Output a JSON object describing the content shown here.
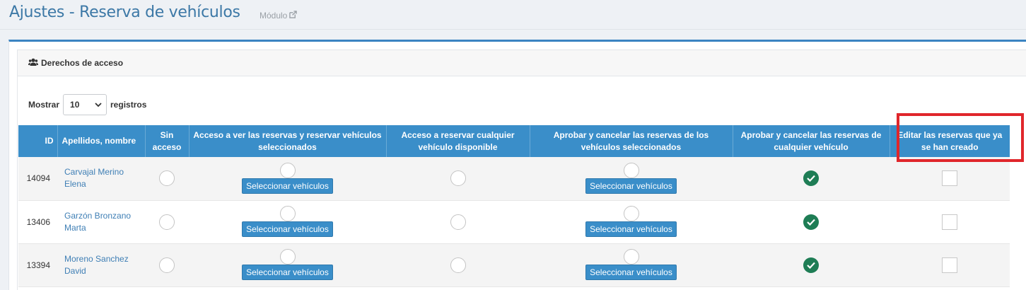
{
  "header": {
    "title": "Ajustes - Reserva de vehículos",
    "module_link": "Módulo"
  },
  "panel": {
    "title": "Derechos de acceso"
  },
  "length": {
    "prefix": "Mostrar",
    "selected": "10",
    "suffix": "registros"
  },
  "table": {
    "columns": [
      "ID",
      "Apellidos, nombre",
      "Sin acceso",
      "Acceso a ver las reservas y reservar vehículos seleccionados",
      "Acceso a reservar cualquier vehículo disponible",
      "Aprobar y cancelar las reservas de los vehículos seleccionados",
      "Aprobar y cancelar las reservas de cualquier vehículo",
      "Editar las reservas que ya se han creado"
    ],
    "select_button_label": "Seleccionar vehículos",
    "rows": [
      {
        "id": "14094",
        "name": "Carvajal Merino Elena",
        "selected": "any_vehicle_approve",
        "edit_checked": false
      },
      {
        "id": "13406",
        "name": "Garzón Bronzano Marta",
        "selected": "any_vehicle_approve",
        "edit_checked": false
      },
      {
        "id": "13394",
        "name": "Moreno Sanchez David",
        "selected": "any_vehicle_approve",
        "edit_checked": false
      }
    ]
  },
  "colors": {
    "accent": "#3a8ec9",
    "title": "#3c78a6",
    "success": "#1e7d55",
    "highlight": "#e0262b"
  },
  "icons": {
    "module": "external-link-icon",
    "panel": "users-icon",
    "select": "chevron-down-icon",
    "selected": "check-circle-icon"
  }
}
